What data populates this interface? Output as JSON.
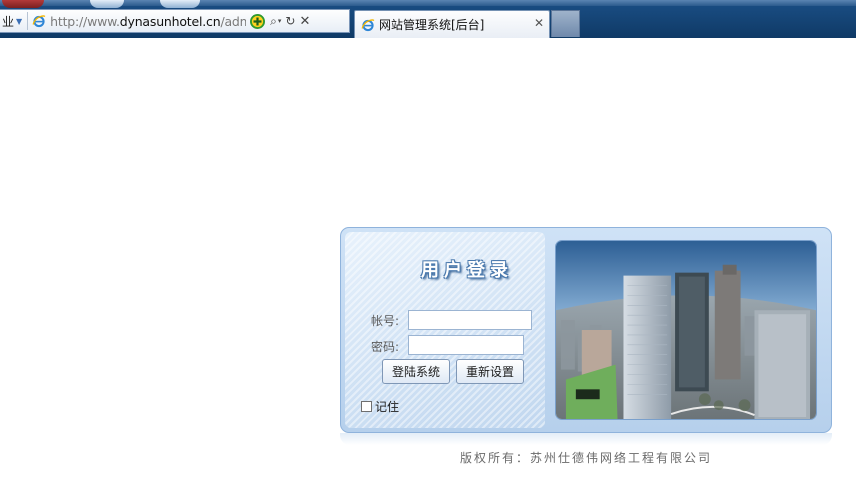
{
  "browser": {
    "address_stub": "业",
    "url_prefix": "http://www.",
    "url_domain": "dynasunhotel.cn",
    "url_path": "/admin",
    "tab_title": "网站管理系统[后台]",
    "tab_close": "✕",
    "search_glyph": "⌕",
    "dropdown_glyph": "▾",
    "refresh_glyph": "↻",
    "stop_glyph": "✕"
  },
  "login": {
    "title": "用户登录",
    "username_label": "帐号:",
    "username_value": "",
    "password_label": "密码:",
    "password_value": "",
    "login_button": "登陆系统",
    "reset_button": "重新设置",
    "remember_label": "记住",
    "remember_checked": false
  },
  "footer": {
    "copyright": "版权所有：苏州仕德伟网络工程有限公司"
  },
  "colors": {
    "chrome": "#173f6b",
    "panel": "#c4d9f0",
    "title_stroke": "#4a79ad"
  }
}
